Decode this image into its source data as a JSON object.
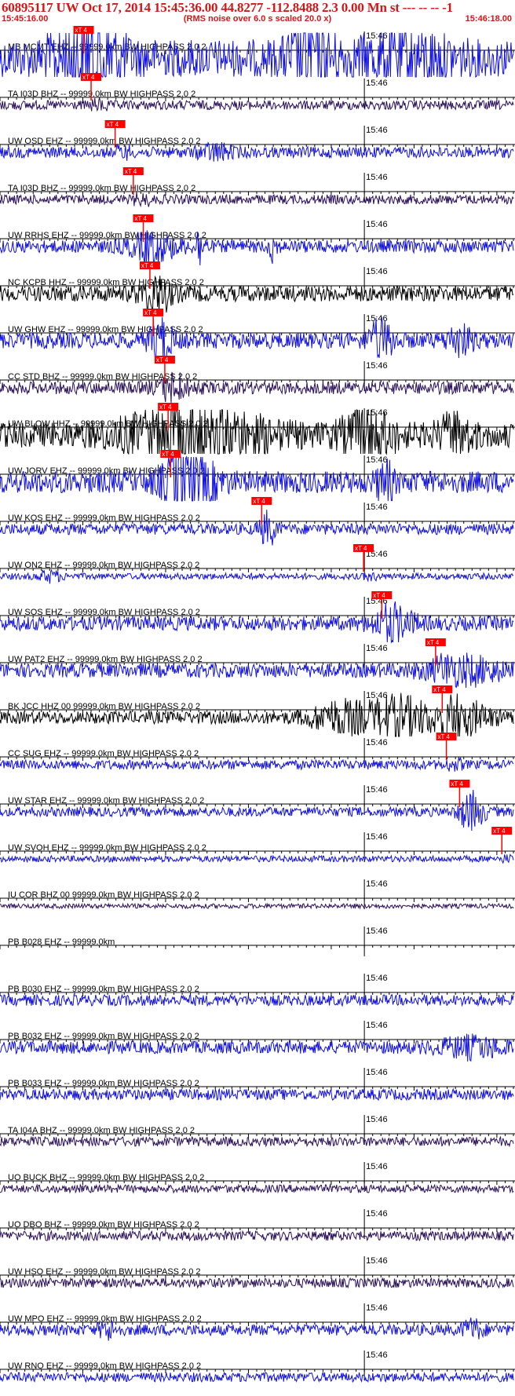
{
  "header": {
    "title": "60895117 UW Oct 17, 2014 15:45:36.00   44.8277 -112.8488  2.3 0.00 Mn st --- -- --   -1",
    "start_time": "15:45:16.00",
    "rms_note": "(RMS noise over 6.0 s scaled 20.0 x)",
    "end_time": "15:46:18.00"
  },
  "chart_data": {
    "type": "line",
    "title": "60895117 UW Oct 17, 2014 15:45:36.00   44.8277 -112.8488  2.3 0.00 Mn st --- -- --   -1",
    "time_start": "15:45:16.00",
    "time_end": "15:46:18.00",
    "xlim_seconds": [
      0,
      62
    ],
    "minute_tick_label": "15:46",
    "minute_tick_seconds": 44,
    "pick_label": "xT 4",
    "colors": {
      "blue": "#1010e0",
      "black": "#000000",
      "purple": "#2a0f5a",
      "pick": "#ff0000"
    },
    "traces": [
      {
        "label": "MB MCMT EHZ -- 99999.0km BW  HIGHPASS  2.0  2",
        "color": "blue",
        "amp": 24,
        "pick": 10.1,
        "bursts": [
          [
            10.5,
            3.5,
            2.6
          ],
          [
            37.5,
            2.5,
            1.5
          ],
          [
            48.5,
            5,
            1.1
          ]
        ]
      },
      {
        "label": "TA I03D BHZ -- 99999.0km BW  HIGHPASS  2.0  2",
        "color": "purple",
        "amp": 6,
        "pick": 11.0,
        "bursts": []
      },
      {
        "label": "UW OSD EHZ -- 99999.0km BW  HIGHPASS  2.0  2",
        "color": "blue",
        "amp": 7,
        "pick": 13.9,
        "bursts": [
          [
            26,
            2,
            1.2
          ]
        ]
      },
      {
        "label": "TA I03D BHZ -- 99999.0km BW  HIGHPASS  2.0  2",
        "color": "purple",
        "amp": 6,
        "pick": 16.1,
        "bursts": []
      },
      {
        "label": "UW RRHS EHZ -- 99999.0km BW  HIGHPASS  2.0  2",
        "color": "blue",
        "amp": 8,
        "pick": 17.3,
        "bursts": [
          [
            18.5,
            3,
            1.8
          ],
          [
            24.2,
            0.5,
            3.5
          ],
          [
            33,
            0.4,
            2.5
          ]
        ]
      },
      {
        "label": "NC KCPB HHZ -- 99999.0km BW  HIGHPASS  2.0  2",
        "color": "black",
        "amp": 10,
        "pick": 18.1,
        "bursts": [
          [
            18.8,
            2,
            1.5
          ]
        ]
      },
      {
        "label": "UW GHW EHZ -- 99999.0km BW  HIGHPASS  2.0  2",
        "color": "blue",
        "amp": 10,
        "pick": 18.5,
        "bursts": [
          [
            19.4,
            1.5,
            2.0
          ],
          [
            46,
            1.5,
            2.2
          ],
          [
            55.5,
            1.5,
            1.6
          ]
        ]
      },
      {
        "label": "CC STD BHZ -- 99999.0km BW  HIGHPASS  2.0  2",
        "color": "purple",
        "amp": 8,
        "pick": 19.9,
        "bursts": [
          [
            21,
            2,
            1.3
          ]
        ]
      },
      {
        "label": "UW BLOW HHZ -- 99999.0km BW  HIGHPASS  2.0  2",
        "color": "black",
        "amp": 16,
        "pick": 20.3,
        "bursts": [
          [
            23.5,
            8,
            2.0
          ],
          [
            44.5,
            3,
            1.8
          ],
          [
            55,
            2,
            1.2
          ]
        ]
      },
      {
        "label": "UW JORV EHZ -- 99999.0km BW  HIGHPASS  2.0  2",
        "color": "blue",
        "amp": 14,
        "pick": 20.6,
        "bursts": [
          [
            22.8,
            3,
            2.8
          ],
          [
            46.5,
            1,
            1.5
          ]
        ]
      },
      {
        "label": "UW KOS EHZ -- 99999.0km BW  HIGHPASS  2.0  2",
        "color": "blue",
        "amp": 7,
        "pick": 31.6,
        "bursts": [
          [
            32.3,
            1,
            2.0
          ]
        ]
      },
      {
        "label": "UW ON2 EHZ -- 99999.0km BW  HIGHPASS  2.0  2",
        "color": "blue",
        "amp": 4,
        "pick": 43.9,
        "bursts": [
          [
            6,
            1.5,
            1.5
          ]
        ]
      },
      {
        "label": "UW SOS EHZ -- 99999.0km BW  HIGHPASS  2.0  2",
        "color": "blue",
        "amp": 9,
        "pick": 46.1,
        "bursts": [
          [
            47.5,
            2.5,
            2.0
          ]
        ]
      },
      {
        "label": "UW PAT2 EHZ -- 99999.0km BW  HIGHPASS  2.0  2",
        "color": "blue",
        "amp": 9,
        "pick": 52.6,
        "bursts": [
          [
            56,
            4.5,
            1.6
          ]
        ]
      },
      {
        "label": "BK JCC HHZ 00 99999.0km BW  HIGHPASS  2.0  2",
        "color": "black",
        "amp": 8,
        "pick": 53.4,
        "bursts": [
          [
            41,
            3.5,
            2.2
          ],
          [
            48,
            3.5,
            3.0
          ],
          [
            55.5,
            3.5,
            2.6
          ]
        ]
      },
      {
        "label": "CC SUG EHZ -- 99999.0km BW  HIGHPASS  2.0  2",
        "color": "blue",
        "amp": 6,
        "pick": 53.9,
        "bursts": []
      },
      {
        "label": "UW STAR EHZ -- 99999.0km BW  HIGHPASS  2.0  2",
        "color": "blue",
        "amp": 6,
        "pick": 55.5,
        "bursts": [
          [
            57,
            1.5,
            3.2
          ]
        ]
      },
      {
        "label": "UW SVOH EHZ -- 99999.0km BW  HIGHPASS  2.0  2",
        "color": "blue",
        "amp": 4,
        "pick": 60.6,
        "bursts": []
      },
      {
        "label": "IU COR BHZ 00 99999.0km BW  HIGHPASS  2.0  2",
        "color": "purple",
        "amp": 3,
        "bursts": []
      },
      {
        "label": "PB B028 EHZ -- 99999.0km",
        "color": "none",
        "amp": 0,
        "bursts": []
      },
      {
        "label": "PB B030 EHZ -- 99999.0km BW  HIGHPASS  2.0  2",
        "color": "blue",
        "amp": 7,
        "bursts": []
      },
      {
        "label": "PB B032 EHZ -- 99999.0km BW  HIGHPASS  2.0  2",
        "color": "blue",
        "amp": 8,
        "bursts": [
          [
            57,
            4,
            1.3
          ]
        ]
      },
      {
        "label": "PB B033 EHZ -- 99999.0km BW  HIGHPASS  2.0  2",
        "color": "blue",
        "amp": 7,
        "bursts": []
      },
      {
        "label": "TA I04A BHZ -- 99999.0km BW  HIGHPASS  2.0  2",
        "color": "purple",
        "amp": 6,
        "bursts": []
      },
      {
        "label": "UO BUCK BHZ -- 99999.0km BW  HIGHPASS  2.0  2",
        "color": "purple",
        "amp": 5,
        "bursts": []
      },
      {
        "label": "UO DBO BHZ -- 99999.0km BW  HIGHPASS  2.0  2",
        "color": "purple",
        "amp": 6,
        "bursts": []
      },
      {
        "label": "UW HSO EHZ -- 99999.0km BW  HIGHPASS  2.0  2",
        "color": "purple",
        "amp": 6,
        "bursts": []
      },
      {
        "label": "UW MPO EHZ -- 99999.0km BW  HIGHPASS  2.0  2",
        "color": "blue",
        "amp": 7,
        "bursts": [
          [
            13,
            1,
            1.4
          ],
          [
            57,
            1.2,
            1.6
          ]
        ]
      },
      {
        "label": "UW RNO EHZ -- 99999.0km BW  HIGHPASS  2.0  2",
        "color": "blue",
        "amp": 6,
        "bursts": []
      }
    ]
  }
}
